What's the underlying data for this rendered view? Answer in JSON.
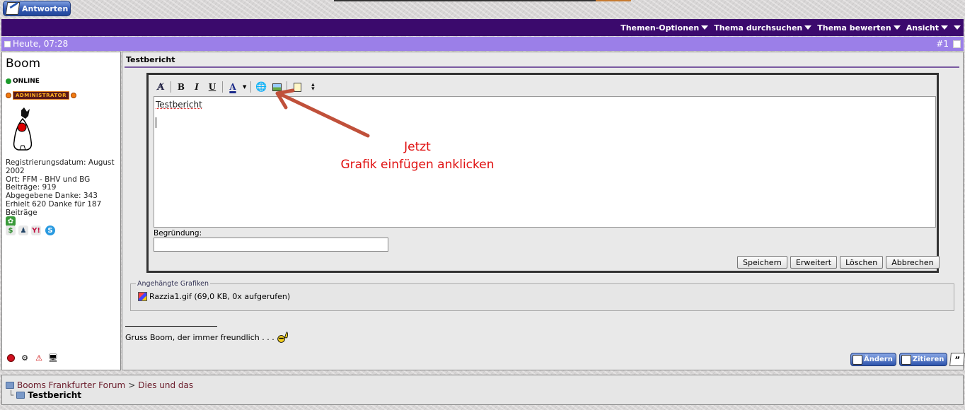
{
  "toolbar_top": {
    "reply_label": "Antworten"
  },
  "nav": {
    "items": [
      "Themen-Optionen",
      "Thema durchsuchen",
      "Thema bewerten",
      "Ansicht"
    ]
  },
  "post": {
    "date": "Heute, 07:28",
    "number": "#1",
    "title": "Testbericht"
  },
  "user": {
    "name": "Boom",
    "online": "ONLINE",
    "role": "ADMINISTRATOR",
    "stats": [
      "Registrierungsdatum: August 2002",
      "Ort: FFM - BHV und BG",
      "Beiträge: 919",
      "Abgegebene Danke: 343",
      "Erhielt 620 Danke für 187 Beiträge"
    ]
  },
  "editor": {
    "text": "Testbericht",
    "reason_label": "Begründung:",
    "reason_value": "",
    "buttons": {
      "save": "Speichern",
      "advanced": "Erweitert",
      "delete": "Löschen",
      "cancel": "Abbrechen"
    }
  },
  "annotation": {
    "line1": "Jetzt",
    "line2": "Grafik einfügen anklicken",
    "color": "#e01010"
  },
  "attachments": {
    "legend": "Angehängte Grafiken",
    "file": "Razzia1.gif (69,0 KB, 0x aufgerufen)"
  },
  "signature": {
    "text": "Gruss Boom, der immer freundlich . . ."
  },
  "actions": {
    "edit": "Ändern",
    "quote": "Zitieren"
  },
  "breadcrumb": {
    "forum": "Booms Frankfurter Forum",
    "separator": ">",
    "section": "Dies und das",
    "current": "Testbericht"
  },
  "colors": {
    "nav_bg": "#3b0a6d",
    "date_bar": "#9b7fe8",
    "accent": "#2f56b0"
  }
}
